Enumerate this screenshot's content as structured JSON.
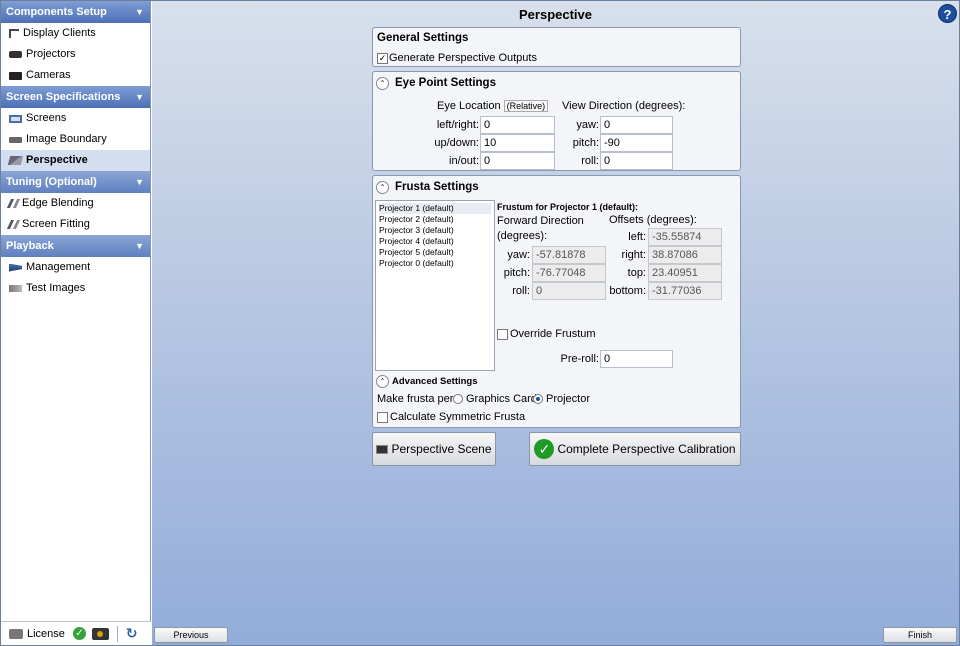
{
  "sidebar": {
    "sections": [
      {
        "label": "Components Setup",
        "items": [
          {
            "label": "Display Clients",
            "icon": "tree-icon"
          },
          {
            "label": "Projectors",
            "icon": "projector-icon"
          },
          {
            "label": "Cameras",
            "icon": "camera-icon"
          }
        ]
      },
      {
        "label": "Screen Specifications",
        "items": [
          {
            "label": "Screens",
            "icon": "screen-icon"
          },
          {
            "label": "Image Boundary",
            "icon": "boundary-icon"
          },
          {
            "label": "Perspective",
            "icon": "perspective-icon",
            "selected": true
          }
        ]
      },
      {
        "label": "Tuning (Optional)",
        "items": [
          {
            "label": "Edge Blending",
            "icon": "blend-icon"
          },
          {
            "label": "Screen Fitting",
            "icon": "fitting-icon"
          }
        ]
      },
      {
        "label": "Playback",
        "items": [
          {
            "label": "Management",
            "icon": "management-icon"
          },
          {
            "label": "Test Images",
            "icon": "test-images-icon"
          }
        ]
      }
    ],
    "footer": {
      "license_label": "License"
    }
  },
  "page_title": "Perspective",
  "general": {
    "title": "General Settings",
    "generate_label": "Generate Perspective Outputs",
    "generate_checked": true
  },
  "eye": {
    "title": "Eye Point Settings",
    "location_header": "Eye Location",
    "relative_badge": "(Relative)",
    "view_header": "View Direction (degrees):",
    "left_right_label": "left/right:",
    "left_right": "0",
    "up_down_label": "up/down:",
    "up_down": "10",
    "in_out_label": "in/out:",
    "in_out": "0",
    "yaw_label": "yaw:",
    "yaw": "0",
    "pitch_label": "pitch:",
    "pitch": "-90",
    "roll_label": "roll:",
    "roll": "0"
  },
  "frusta": {
    "title": "Frusta Settings",
    "projectors": [
      "Projector 1 (default)",
      "Projector 2 (default)",
      "Projector 3 (default)",
      "Projector 4 (default)",
      "Projector 5 (default)",
      "Projector 0 (default)"
    ],
    "frustum_title": "Frustum for Projector 1 (default):",
    "forward_header": "Forward Direction (degrees):",
    "offsets_header": "Offsets (degrees):",
    "yaw_label": "yaw:",
    "yaw": "-57.81878",
    "pitch_label": "pitch:",
    "pitch": "-76.77048",
    "roll_label": "roll:",
    "roll": "0",
    "left_label": "left:",
    "left": "-35.55874",
    "right_label": "right:",
    "right": "38.87086",
    "top_label": "top:",
    "top": "23.40951",
    "bottom_label": "bottom:",
    "bottom": "-31.77036",
    "override_label": "Override Frustum",
    "override_checked": false,
    "preroll_label": "Pre-roll:",
    "preroll": "0",
    "advanced_title": "Advanced Settings",
    "make_frusta_label": "Make frusta per",
    "graphics_card_label": "Graphics Card",
    "projector_label": "Projector",
    "mode": "Projector",
    "symmetric_label": "Calculate Symmetric Frusta",
    "symmetric_checked": false
  },
  "buttons": {
    "scene": "Perspective Scene",
    "complete": "Complete Perspective Calibration",
    "previous": "Previous",
    "finish": "Finish"
  }
}
